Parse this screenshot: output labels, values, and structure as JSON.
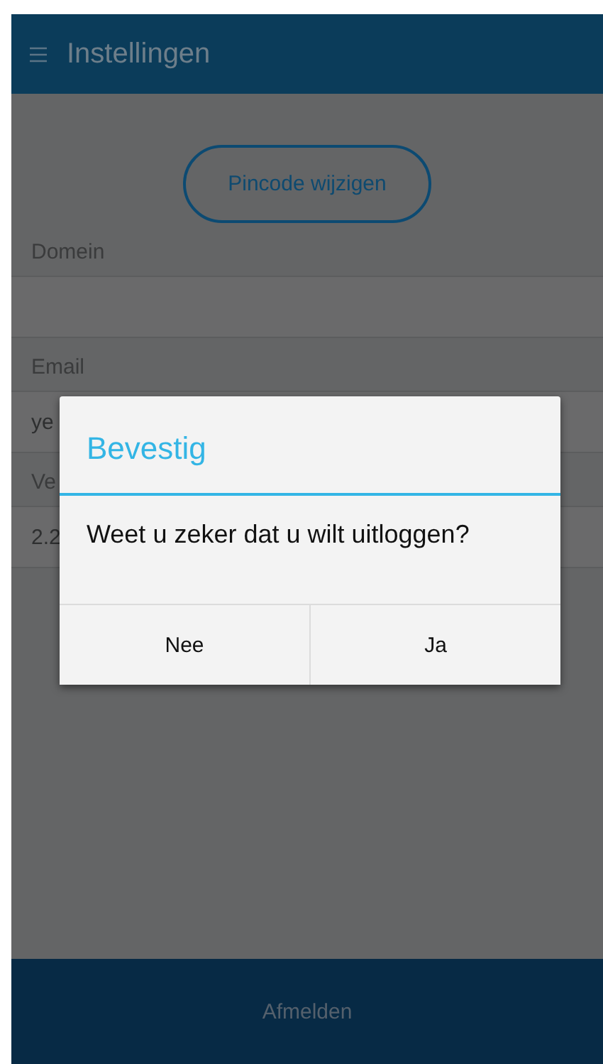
{
  "header": {
    "title": "Instellingen"
  },
  "change_pin_button": {
    "label": "Pincode wijzigen"
  },
  "fields": [
    {
      "label": "Domein"
    },
    {
      "label": "Email",
      "value": "ye"
    },
    {
      "label": "Ve",
      "value": "2.2"
    }
  ],
  "dialog": {
    "title": "Bevestig",
    "message": "Weet u zeker dat u wilt uitloggen?",
    "buttons": [
      {
        "label": "Nee"
      },
      {
        "label": "Ja"
      }
    ]
  },
  "footer": {
    "label": "Afmelden"
  }
}
